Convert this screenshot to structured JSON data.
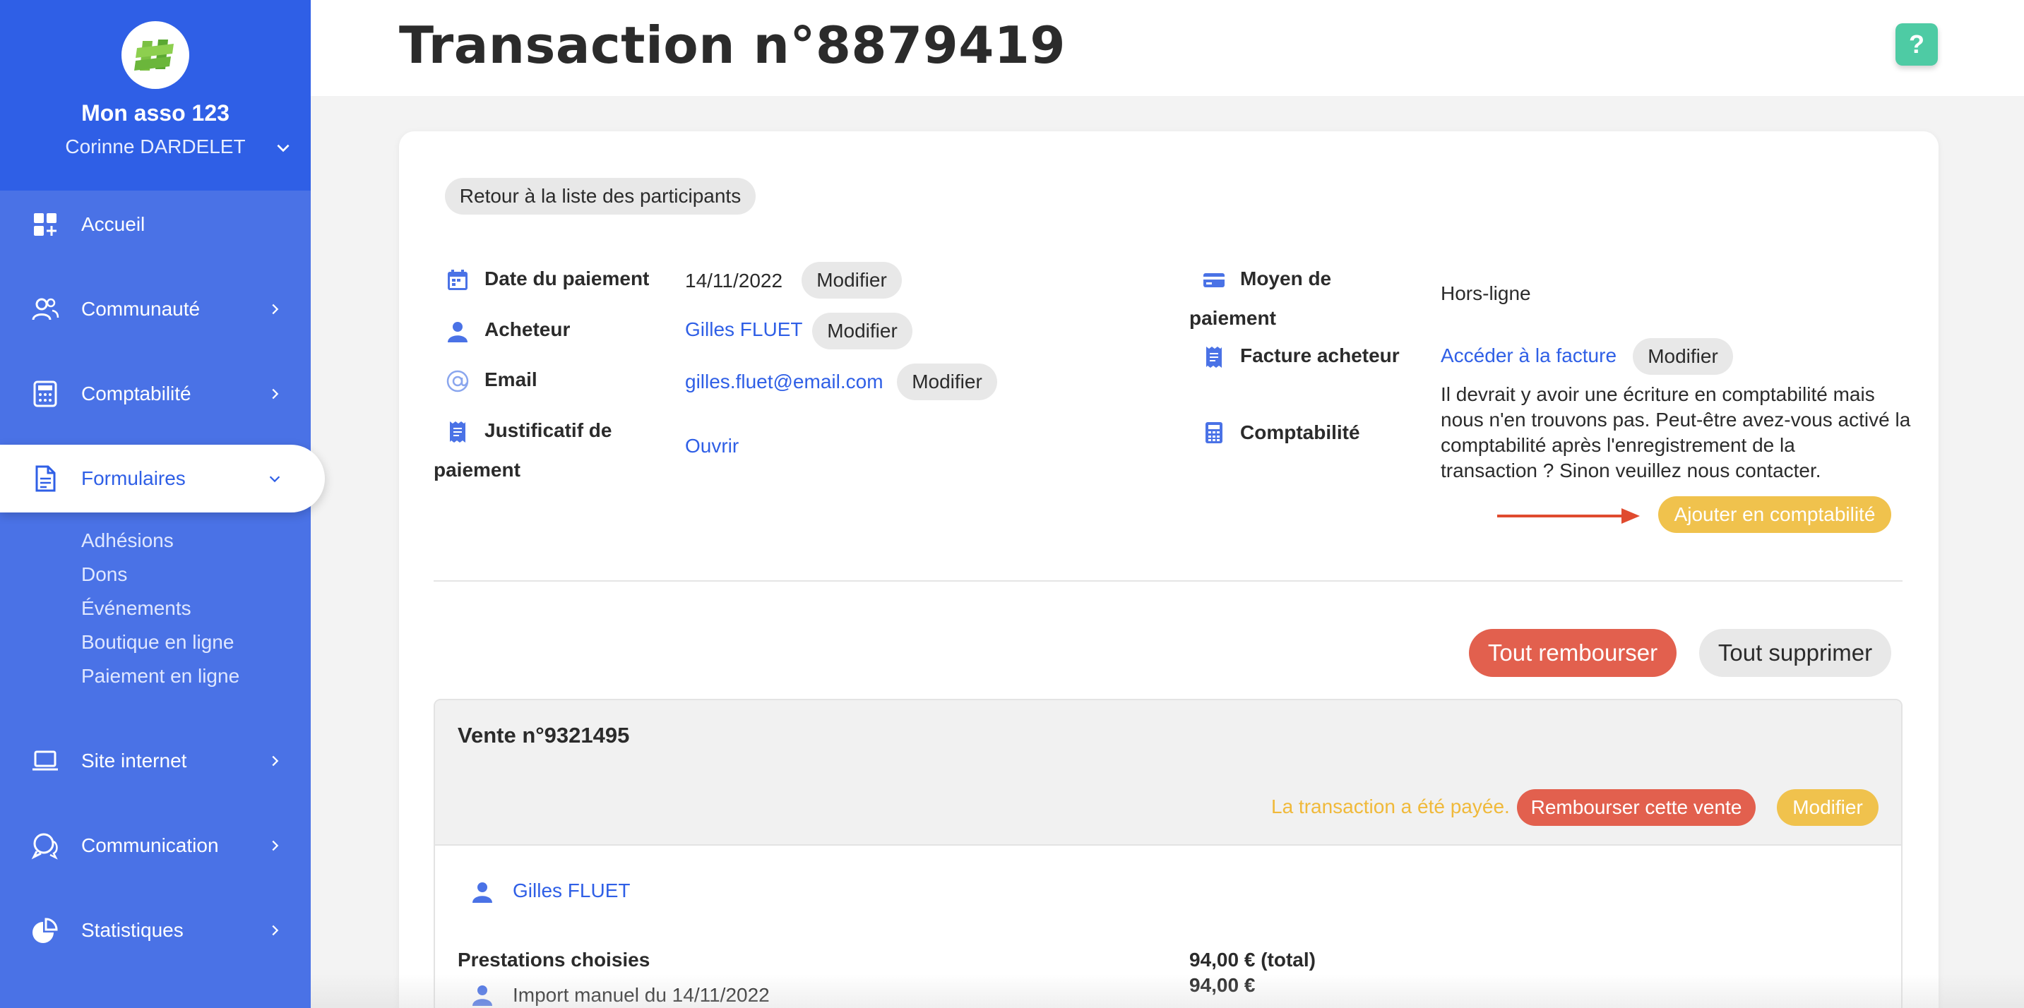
{
  "sidebar": {
    "org_name": "Mon asso 123",
    "user_name": "Corinne DARDELET",
    "nav": [
      {
        "label": "Accueil",
        "icon": "dashboard-icon"
      },
      {
        "label": "Communauté",
        "icon": "community-icon"
      },
      {
        "label": "Comptabilité",
        "icon": "calculator-icon"
      },
      {
        "label": "Formulaires",
        "icon": "document-icon"
      },
      {
        "label": "Site internet",
        "icon": "laptop-icon"
      },
      {
        "label": "Communication",
        "icon": "chat-icon"
      },
      {
        "label": "Statistiques",
        "icon": "pie-chart-icon"
      }
    ],
    "sub_items": [
      "Adhésions",
      "Dons",
      "Événements",
      "Boutique en ligne",
      "Paiement en ligne"
    ]
  },
  "header": {
    "title": "Transaction n°8879419",
    "help_label": "?"
  },
  "back_button": "Retour à la liste des participants",
  "details_left": {
    "date_label": "Date du paiement",
    "date_value": "14/11/2022",
    "buyer_label": "Acheteur",
    "buyer_value": "Gilles FLUET",
    "email_label": "Email",
    "email_value": "gilles.fluet@email.com",
    "proof_label_1": "Justificatif de",
    "proof_label_2": "paiement",
    "proof_value": "Ouvrir",
    "modify": "Modifier"
  },
  "details_right": {
    "method_label_1": "Moyen de",
    "method_label_2": "paiement",
    "method_value": "Hors-ligne",
    "invoice_label": "Facture acheteur",
    "invoice_link": "Accéder à la facture",
    "accounting_label": "Comptabilité",
    "accounting_lines": [
      "Il devrait y avoir une écriture en comptabilité mais",
      "nous n'en trouvons pas. Peut-être avez-vous activé la",
      "comptabilité après l'enregistrement de la",
      "transaction ? Sinon veuillez nous contacter."
    ],
    "add_accounting": "Ajouter en comptabilité"
  },
  "actions": {
    "refund_all": "Tout rembourser",
    "delete_all": "Tout supprimer"
  },
  "sale": {
    "title": "Vente n°9321495",
    "status": "La transaction a été payée.",
    "refund_sale": "Rembourser cette vente",
    "modify": "Modifier",
    "buyer": "Gilles FLUET",
    "services_label": "Prestations choisies",
    "import_label": "Import manuel du 14/11/2022",
    "total": "94,00 € (total)",
    "amount": "94,00 €"
  },
  "colors": {
    "sidebar_blue": "#4a72e6",
    "sidebar_header": "#2f5fe6",
    "link_blue": "#2f5fe6",
    "refund_red": "#e2604e",
    "accent_yellow": "#f0c24d",
    "status_yellow": "#f0b93a",
    "help_green": "#4ecba4",
    "arrow_red": "#e04b2f"
  }
}
